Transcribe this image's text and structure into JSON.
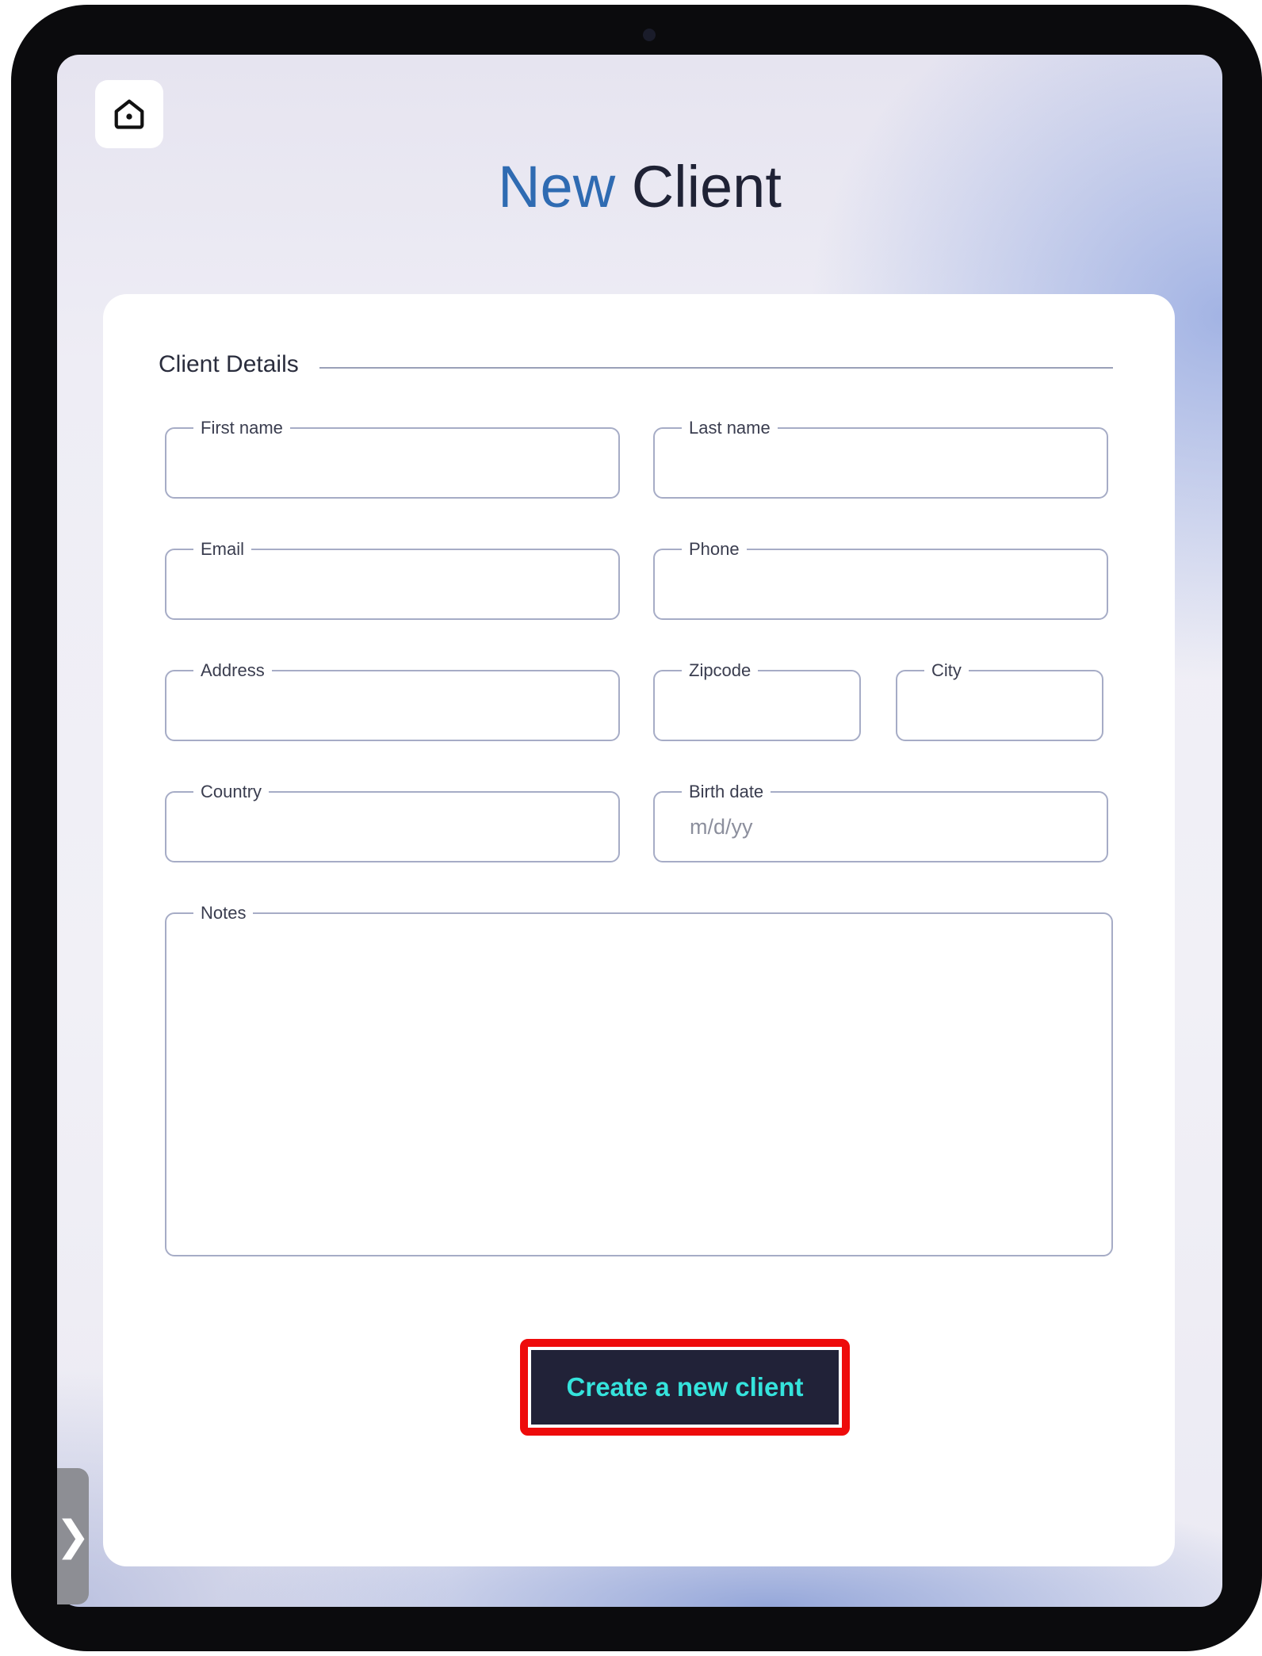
{
  "header": {
    "title_accent": "New",
    "title_rest": "Client"
  },
  "form": {
    "section_title": "Client Details",
    "fields": {
      "first_name": {
        "label": "First name",
        "value": "",
        "placeholder": ""
      },
      "last_name": {
        "label": "Last name",
        "value": "",
        "placeholder": ""
      },
      "email": {
        "label": "Email",
        "value": "",
        "placeholder": ""
      },
      "phone": {
        "label": "Phone",
        "value": "",
        "placeholder": ""
      },
      "address": {
        "label": "Address",
        "value": "",
        "placeholder": ""
      },
      "zipcode": {
        "label": "Zipcode",
        "value": "",
        "placeholder": ""
      },
      "city": {
        "label": "City",
        "value": "",
        "placeholder": ""
      },
      "country": {
        "label": "Country",
        "value": "",
        "placeholder": ""
      },
      "birth_date": {
        "label": "Birth date",
        "value": "",
        "placeholder": "m/d/yy"
      },
      "notes": {
        "label": "Notes",
        "value": "",
        "placeholder": ""
      }
    },
    "submit_label": "Create a new client"
  },
  "icons": {
    "home": "home-icon",
    "side_handle": "chevron-right-icon",
    "side_handle_glyph": "❯"
  },
  "colors": {
    "title_accent": "#2f6bb2",
    "title_text": "#1f2235",
    "button_bg": "#212238",
    "button_text": "#35e3dc",
    "highlight": "#ee0b0b"
  }
}
